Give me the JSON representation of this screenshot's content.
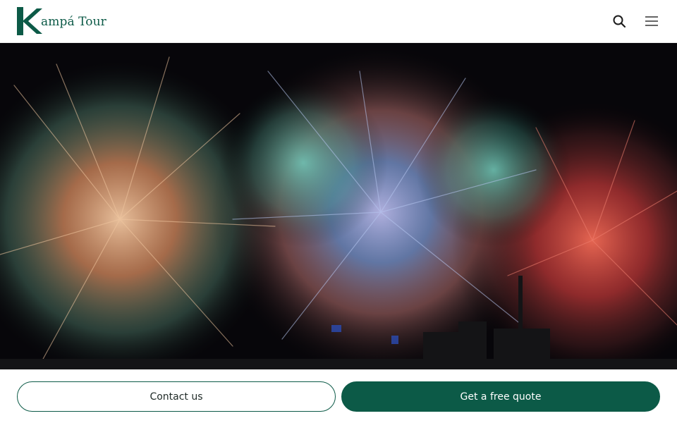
{
  "brand": {
    "name": "ampá Tour",
    "color": "#0c5a47"
  },
  "header": {
    "icons": [
      "search-icon",
      "hamburger-menu-icon"
    ]
  },
  "hero": {
    "image": "fireworks-over-city-skyline"
  },
  "cta": {
    "contact_label": "Contact us",
    "quote_label": "Get a free quote"
  }
}
